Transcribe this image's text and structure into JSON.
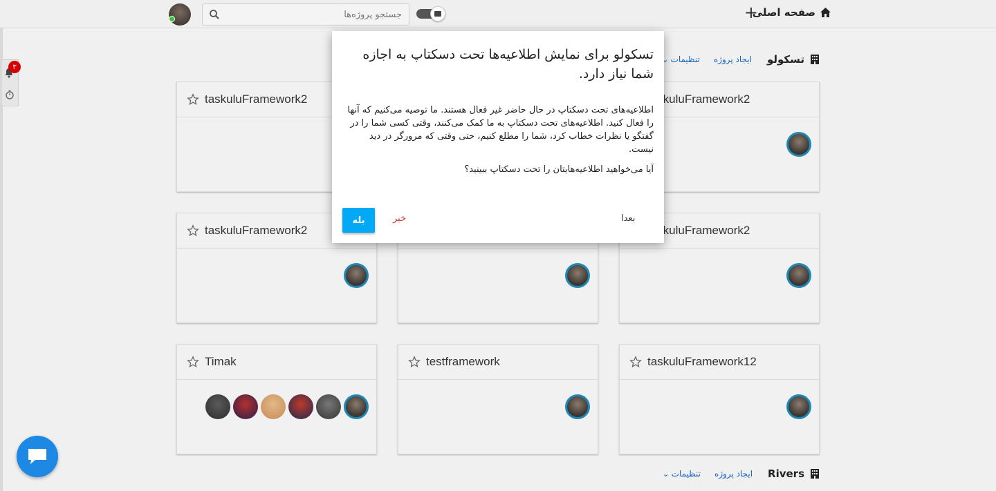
{
  "topbar": {
    "home_label": "صفحه اصلی",
    "search_placeholder": "جستجو پروژه‌ها"
  },
  "notifications": {
    "count": "۳"
  },
  "sections": [
    {
      "title": "تسکولو",
      "create_project": "ایجاد پروژه",
      "settings": "تنظیمات"
    },
    {
      "title": "Rivers",
      "create_project": "ایجاد پروژه",
      "settings": "تنظیمات"
    }
  ],
  "cards": [
    {
      "name": "taskuluFramework2"
    },
    {
      "name": "taskuluFramework2"
    },
    {
      "name": "taskuluFramework2"
    },
    {
      "name": "taskuluFramework2"
    },
    {
      "name": "Timak"
    },
    {
      "name": "testframework"
    },
    {
      "name": "taskuluFramework12"
    }
  ],
  "dialog": {
    "title": "تسکولو برای نمایش اطلاعیه‌ها تحت دسکتاپ به اجازه شما نیاز دارد.",
    "body": "اطلاعیه‌های تحت دسکتاپ در حال حاضر غیر فعال هستند. ما توصیه می‌کنیم که آنها را فعال کنید. اطلاعیه‌های تحت دسکتاپ به ما کمک می‌کنند، وقتی کسی شما را در گفتگو یا نظرات خطاب کرد، شما را مطلع کنیم، حتی وقتی که مرورگر در دید نیست.",
    "question": "آیا می‌خواهید اطلاعیه‌هایتان را تحت دسکتاپ ببینید؟",
    "later_label": "بعدا",
    "no_label": "خیر",
    "yes_label": "بله"
  },
  "colors": {
    "accent": "#03a9f4",
    "no_button": "#d32f2f",
    "badge": "#d50000",
    "chat": "#1e88e5",
    "avatar_ring": "#1e88b8"
  }
}
